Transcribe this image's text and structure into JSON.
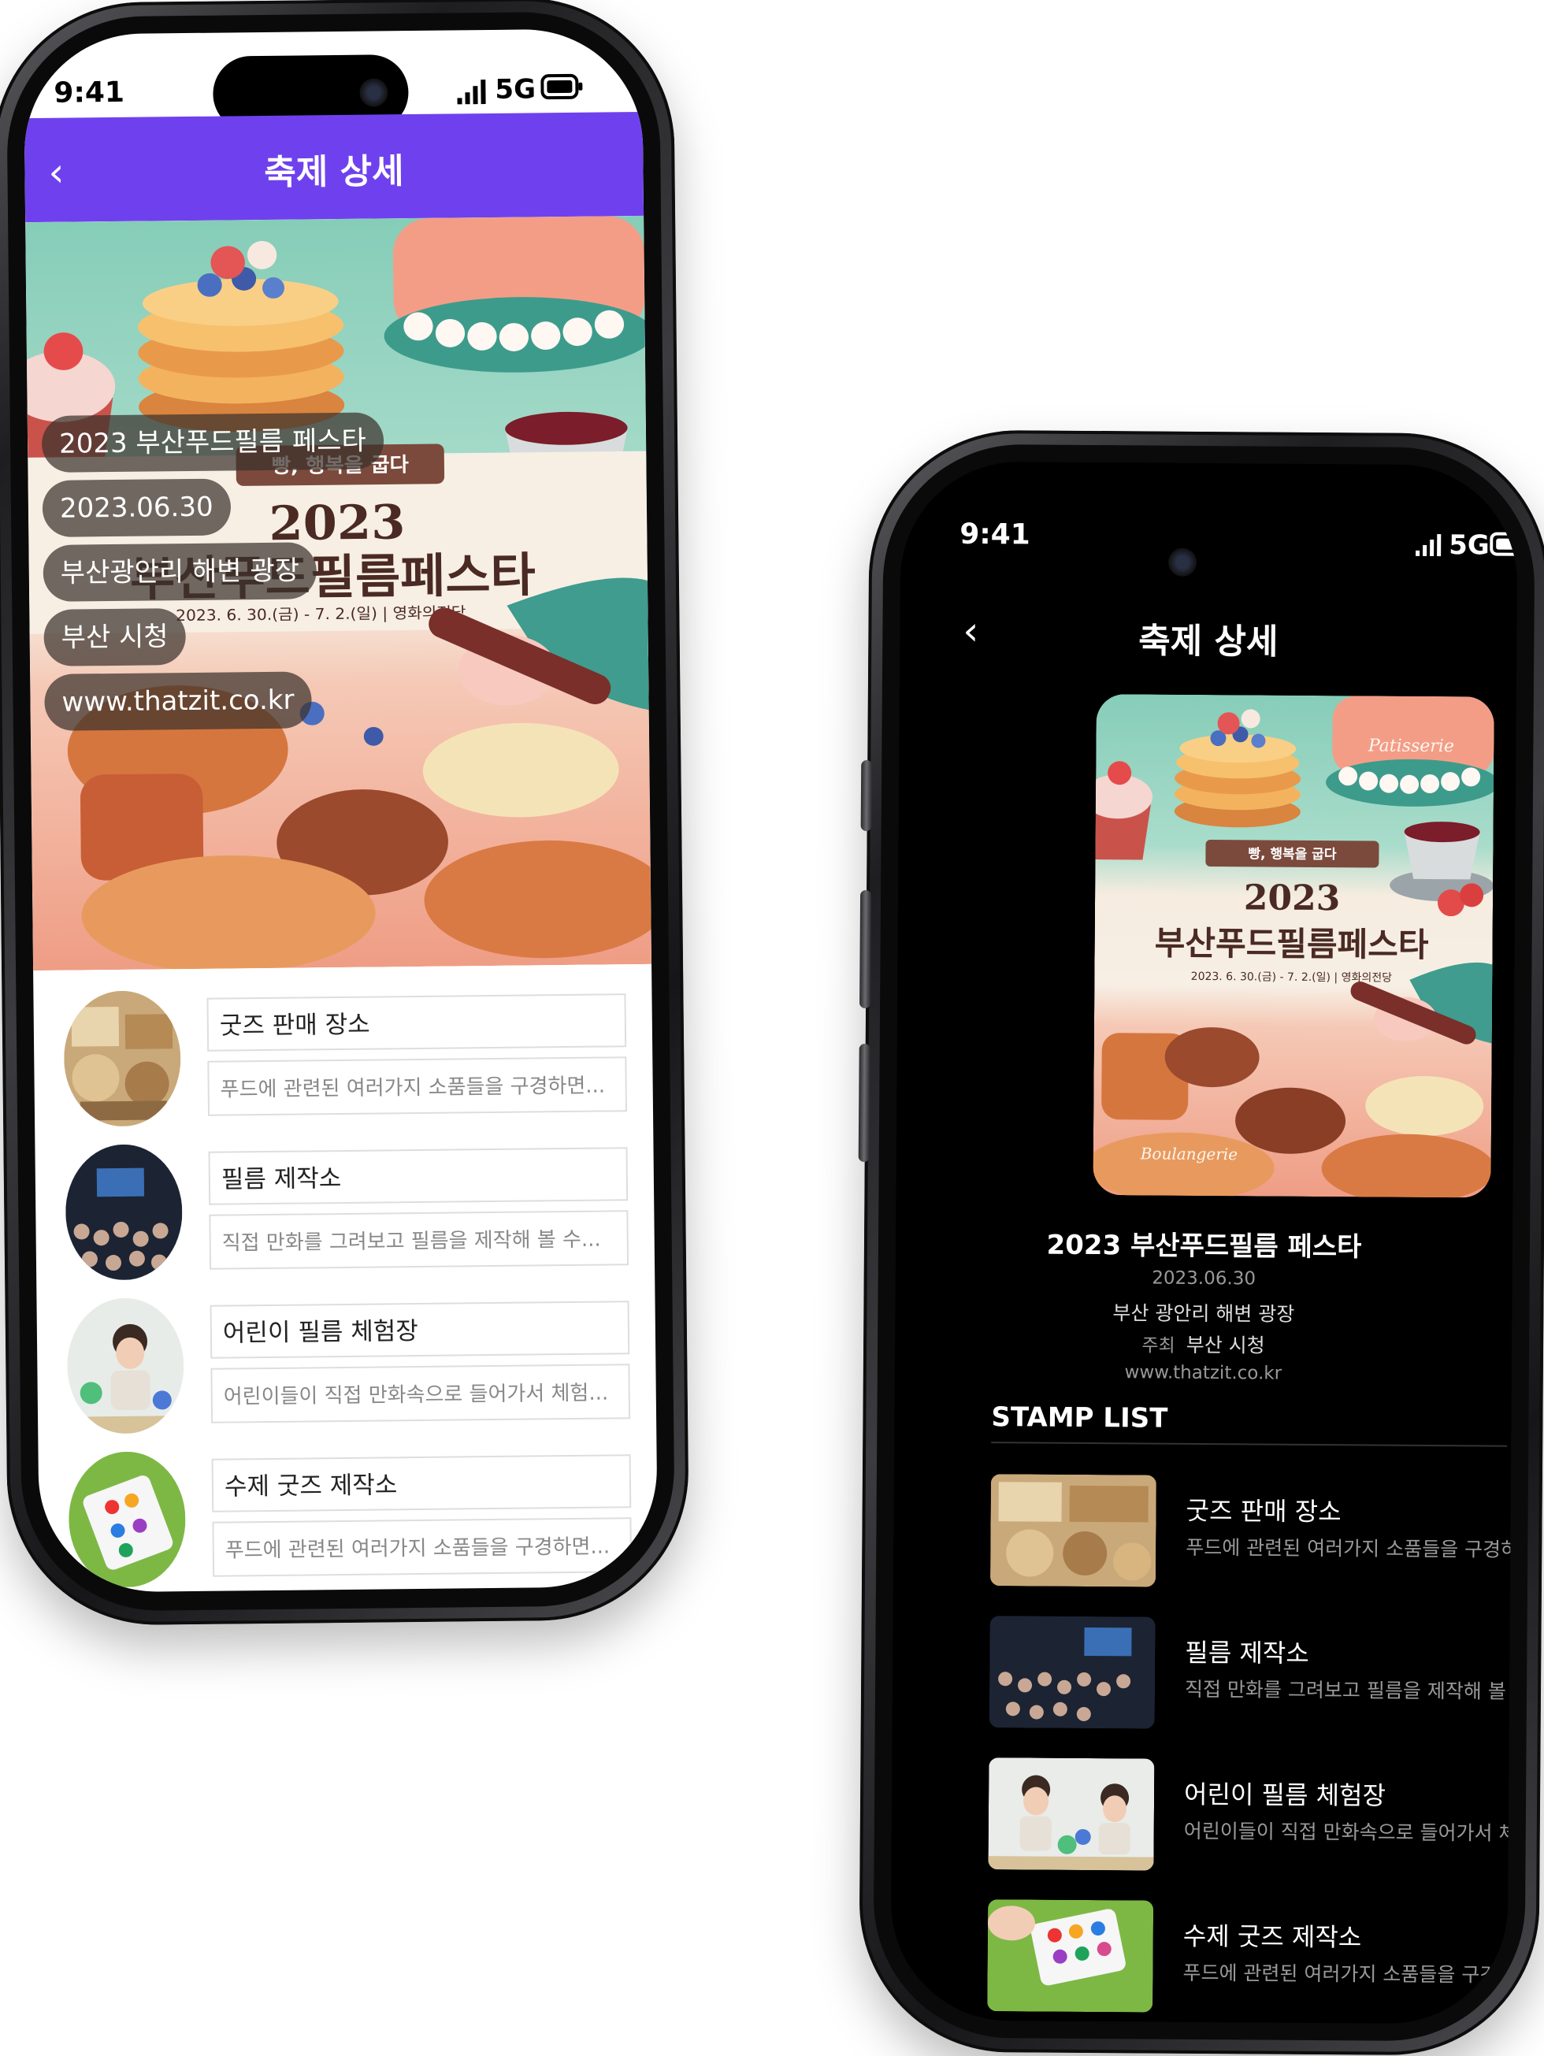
{
  "status": {
    "time": "9:41",
    "network": "5G"
  },
  "header": {
    "title": "축제 상세",
    "back_icon": "chevron-left-icon"
  },
  "poster": {
    "ribbon": "빵, 행복을 굽다",
    "year": "2023",
    "title": "부산푸드필름페스타",
    "dates": "2023. 6. 30.(금) - 7. 2.(일)  |  영화의전당",
    "script_top": "Patisserie",
    "script_bottom": "Boulangerie"
  },
  "festival": {
    "name": "2023 부산푸드필름 페스타",
    "date": "2023.06.30",
    "location": "부산광안리 해변 광장",
    "location_spaced": "부산 광안리 해변 광장",
    "host_label": "주최",
    "host": "부산 시청",
    "url": "www.thatzit.co.kr"
  },
  "stamp_list_title": "STAMP LIST",
  "stamps": [
    {
      "title": "굿즈 판매 장소",
      "desc": "푸드에 관련된 여러가지 소품들을 구경하면..."
    },
    {
      "title": "필름 제작소",
      "desc": "직접 만화를 그려보고 필름을 제작해 볼 수..."
    },
    {
      "title": "어린이 필름 체험장",
      "desc": "어린이들이 직접 만화속으로 들어가서 체험..."
    },
    {
      "title": "수제 굿즈 제작소",
      "desc": "푸드에 관련된 여러가지 소품들을 구경하면..."
    }
  ],
  "colors": {
    "header_purple": "#6f41ee",
    "dark_bg": "#000000",
    "poster_mint": "#7fc9b4",
    "poster_peach": "#f2a48f"
  }
}
